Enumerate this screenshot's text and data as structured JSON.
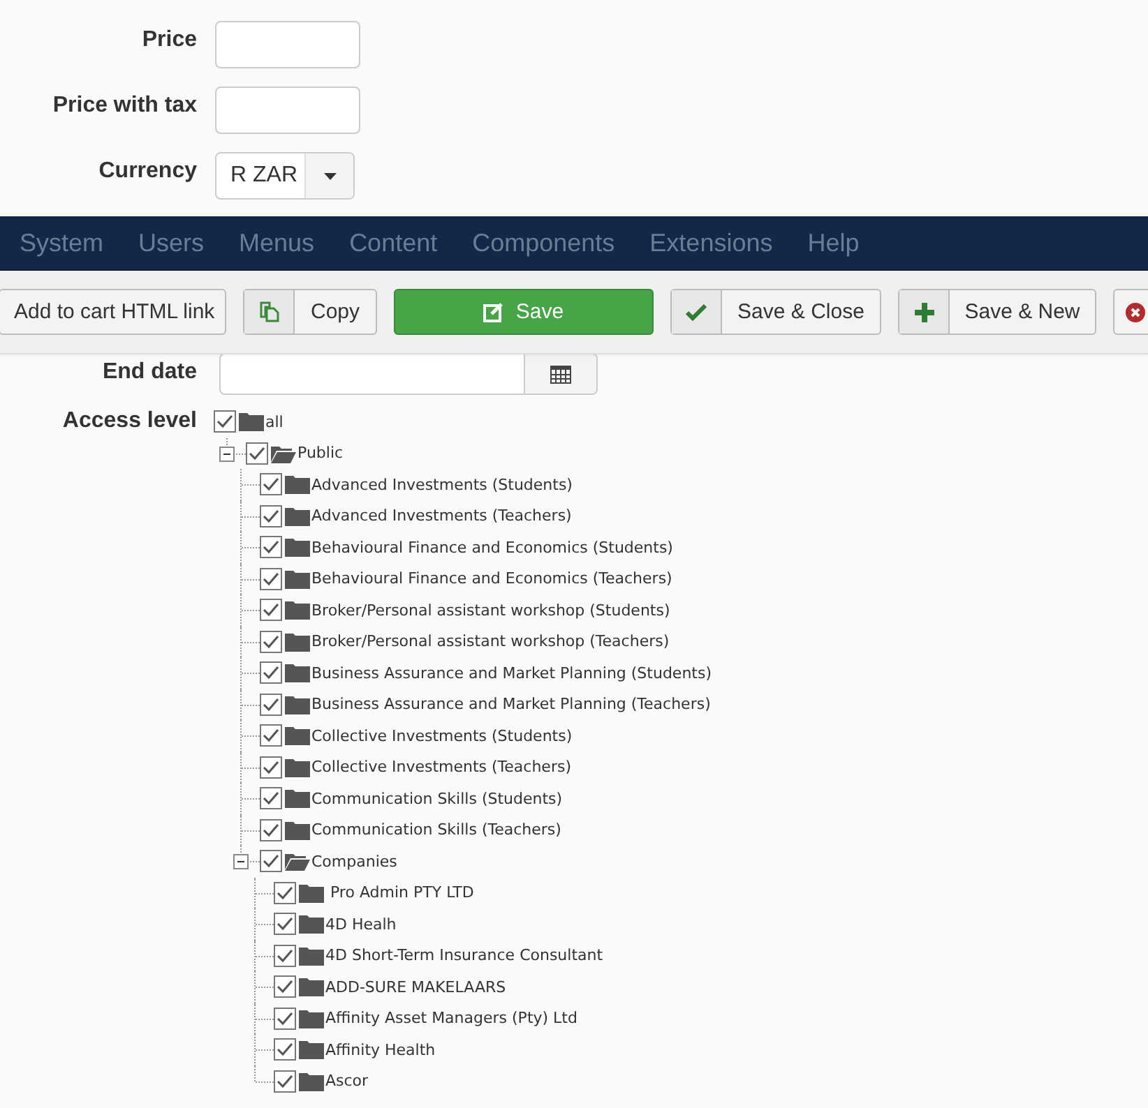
{
  "form": {
    "fields": [
      {
        "label": "Price",
        "kind": "text"
      },
      {
        "label": "Price with tax",
        "kind": "text"
      },
      {
        "label": "Currency",
        "kind": "select",
        "value": "R ZAR"
      }
    ]
  },
  "menu_bar": {
    "items": [
      "System",
      "Users",
      "Menus",
      "Content",
      "Components",
      "Extensions",
      "Help"
    ]
  },
  "toolbar": {
    "buttons": [
      {
        "label": "Add to cart HTML link",
        "kind": "link"
      },
      {
        "label": "Copy",
        "kind": "copy"
      },
      {
        "label": "Save",
        "kind": "save"
      },
      {
        "label": "Save & Close",
        "kind": "apply"
      },
      {
        "label": "Save & New",
        "kind": "new"
      },
      {
        "kind": "cancel"
      }
    ]
  },
  "end_date": {
    "label": "End date"
  },
  "access_level": {
    "label": "Access level",
    "tree": [
      {
        "label": "all",
        "checked": true,
        "children": [
          {
            "label": "Public",
            "checked": true,
            "expanded": true,
            "children": [
              {
                "label": "Advanced Investments (Students)",
                "checked": true
              },
              {
                "label": "Advanced Investments (Teachers)",
                "checked": true
              },
              {
                "label": "Behavioural Finance and Economics (Students)",
                "checked": true
              },
              {
                "label": "Behavioural Finance and Economics (Teachers)",
                "checked": true
              },
              {
                "label": "Broker/Personal assistant workshop (Students)",
                "checked": true
              },
              {
                "label": "Broker/Personal assistant workshop (Teachers)",
                "checked": true
              },
              {
                "label": "Business Assurance and Market Planning (Students)",
                "checked": true
              },
              {
                "label": "Business Assurance and Market Planning (Teachers)",
                "checked": true
              },
              {
                "label": "Collective Investments (Students)",
                "checked": true
              },
              {
                "label": "Collective Investments (Teachers)",
                "checked": true
              },
              {
                "label": "Communication Skills (Students)",
                "checked": true
              },
              {
                "label": "Communication Skills (Teachers)",
                "checked": true
              },
              {
                "label": "Companies",
                "checked": true,
                "expanded": true,
                "children": [
                  {
                    "label": " Pro Admin PTY LTD",
                    "checked": true
                  },
                  {
                    "label": "4D Healh",
                    "checked": true
                  },
                  {
                    "label": "4D Short-Term Insurance Consultant",
                    "checked": true
                  },
                  {
                    "label": "ADD-SURE MAKELAARS",
                    "checked": true
                  },
                  {
                    "label": "Affinity Asset Managers (Pty) Ltd",
                    "checked": true
                  },
                  {
                    "label": "Affinity Health",
                    "checked": true
                  },
                  {
                    "label": "Ascor",
                    "checked": true
                  }
                ]
              }
            ]
          }
        ]
      }
    ]
  }
}
